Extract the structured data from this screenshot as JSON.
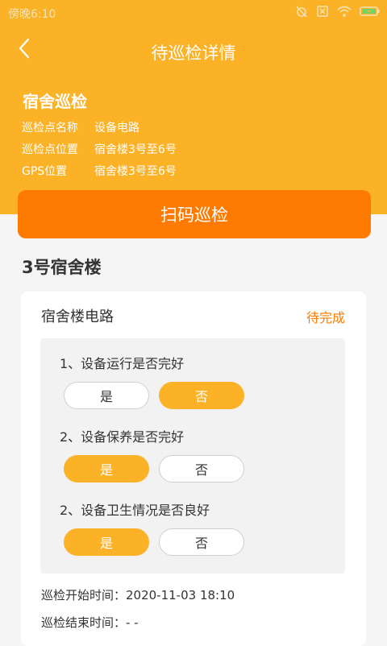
{
  "status_bar": {
    "time": "傍晚6:10",
    "icons": [
      "alarm-off-icon",
      "sim-off-icon",
      "wifi-icon",
      "battery-charging-icon"
    ]
  },
  "nav": {
    "back_icon": "chevron-left-icon",
    "title": "待巡检详情"
  },
  "info": {
    "title": "宿舍巡检",
    "rows": [
      {
        "label": "巡检点名称",
        "value": "设备电路"
      },
      {
        "label": "巡检点位置",
        "value": "宿舍楼3号至6号"
      },
      {
        "label": "GPS位置",
        "value": "宿舍楼3号至6号"
      }
    ]
  },
  "scan_button": {
    "label": "扫码巡检"
  },
  "building": {
    "title": "3号宿舍楼"
  },
  "card": {
    "title": "宿舍楼电路",
    "status": "待完成",
    "questions": [
      {
        "text": "1、设备运行是否完好",
        "yes": "是",
        "no": "否",
        "selected": "no"
      },
      {
        "text": "2、设备保养是否完好",
        "yes": "是",
        "no": "否",
        "selected": "yes"
      },
      {
        "text": "2、设备卫生情况是否良好",
        "yes": "是",
        "no": "否",
        "selected": "yes"
      }
    ],
    "start_time": "巡检开始时间：2020-11-03 18:10",
    "end_time": "巡检结束时间：- -"
  },
  "colors": {
    "header": "#FBB226",
    "scan_button": "#FF7A00",
    "status_pending": "#FF7A00",
    "option_selected": "#FBB226"
  }
}
